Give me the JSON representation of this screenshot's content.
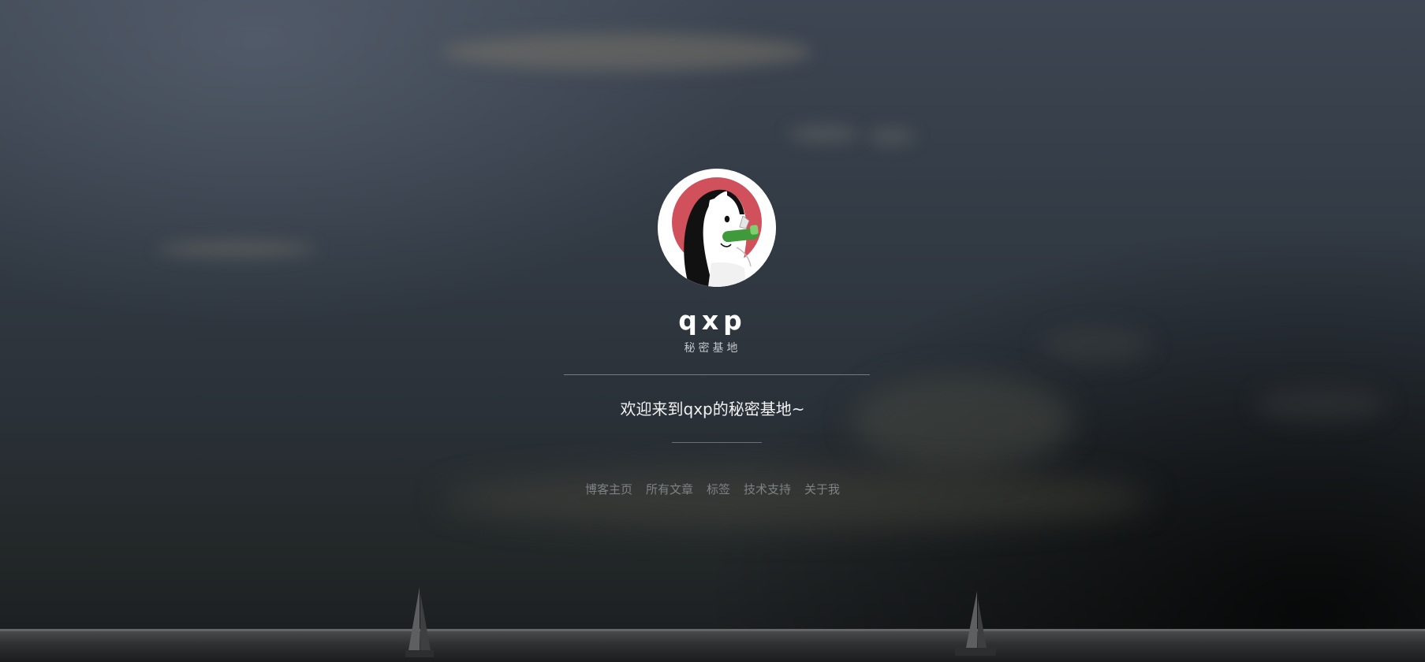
{
  "profile": {
    "name": "qxp",
    "tagline": "秘密基地",
    "avatar_icon": "anime-girl-drinking-avatar-icon"
  },
  "welcome": {
    "text": "欢迎来到qxp的秘密基地~"
  },
  "nav": {
    "items": [
      {
        "label": "博客主页"
      },
      {
        "label": "所有文章"
      },
      {
        "label": "标签"
      },
      {
        "label": "技术支持"
      },
      {
        "label": "关于我"
      }
    ]
  },
  "colors": {
    "background": "#2c333a",
    "title": "#ffffff",
    "nav_link": "#7e8286",
    "avatar_ring": "#d0505b"
  }
}
